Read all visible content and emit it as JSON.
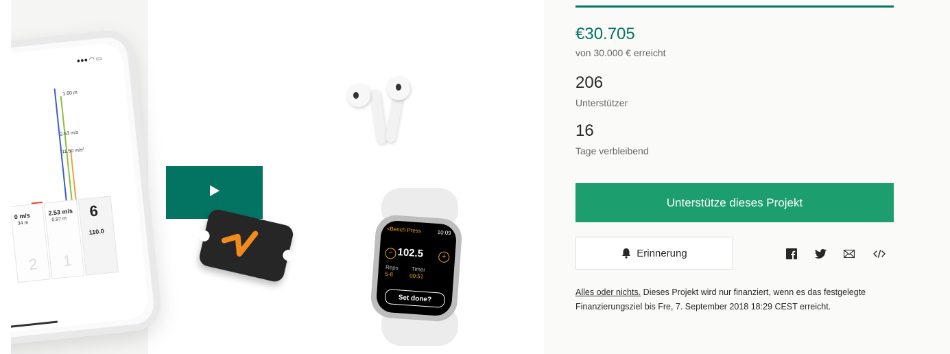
{
  "media": {
    "phone": {
      "status_icons": "●●● ◠ ▭",
      "labels": [
        "1.00 m",
        "2.53 m/s",
        "11.50 m/s²"
      ],
      "cells": [
        "0 m/s",
        "2.53 m/s",
        "6",
        "110.0"
      ],
      "cell_sub": [
        "34 m",
        "0.97 m"
      ],
      "ghost_nums": [
        "2",
        "1"
      ]
    },
    "play_icon": "play-icon",
    "watch": {
      "exercise": "<Bench Press",
      "time": "10:09",
      "weight": "102.5",
      "reps_label": "Reps",
      "reps_value": "5-8",
      "timer_label": "Timer",
      "timer_value": "00:51",
      "set_done": "Set done?"
    }
  },
  "stats": {
    "progress_percent": 100,
    "pledged": "€30.705",
    "goal_text": "von 30.000 € erreicht",
    "backers": "206",
    "backers_label": "Unterstützer",
    "days": "16",
    "days_label": "Tage verbleibend"
  },
  "actions": {
    "back_label": "Unterstütze dieses Projekt",
    "remind_label": "Erinnerung"
  },
  "share": {
    "icons": [
      "facebook-icon",
      "twitter-icon",
      "email-icon",
      "embed-icon"
    ]
  },
  "notice": {
    "link_text": "Alles oder nichts.",
    "text": " Dieses Projekt wird nur finanziert, wenn es das festgelegte Finanzierungsziel bis Fre, 7. September 2018 18:29 CEST erreicht."
  },
  "colors": {
    "accent": "#037362",
    "button": "#1d9e6f",
    "sidebar_bg": "#fafaf8"
  }
}
